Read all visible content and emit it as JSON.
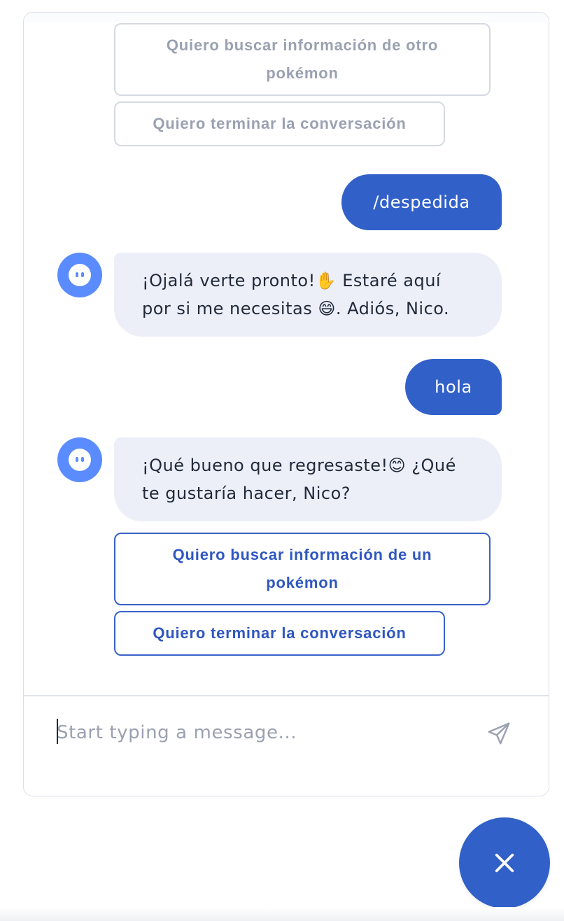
{
  "colors": {
    "primary": "#3160c8",
    "avatar": "#5b8cff",
    "bot_bubble": "#eceff8",
    "disabled_text": "#9aa1b1",
    "border": "#d8dde8"
  },
  "messages": [
    {
      "type": "quick_replies",
      "state": "disabled",
      "options": [
        "Quiero buscar información de otro pokémon",
        "Quiero terminar la conversación"
      ]
    },
    {
      "type": "user",
      "text": "/despedida"
    },
    {
      "type": "bot",
      "avatar_icon": "bot-face-icon",
      "text": "¡Ojalá verte pronto!✋ Estaré aquí por si me necesitas 😄. Adiós, Nico."
    },
    {
      "type": "user",
      "text": "hola"
    },
    {
      "type": "bot",
      "avatar_icon": "bot-face-icon",
      "text": "¡Qué bueno que regresaste!😊 ¿Qué te gustaría hacer, Nico?"
    },
    {
      "type": "quick_replies",
      "state": "active",
      "options": [
        "Quiero buscar información de un pokémon",
        "Quiero terminar la conversación"
      ]
    }
  ],
  "composer": {
    "placeholder": "Start typing a message...",
    "value": "",
    "send_icon": "paper-plane-icon"
  },
  "launcher": {
    "icon": "close-icon"
  }
}
